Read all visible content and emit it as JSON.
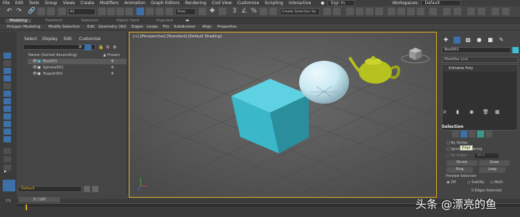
{
  "menu": [
    "File",
    "Edit",
    "Tools",
    "Group",
    "Views",
    "Create",
    "Modifiers",
    "Animation",
    "Graph Editors",
    "Rendering",
    "Civil View",
    "Customize",
    "Scripting",
    "Interactive"
  ],
  "signin": "Sign In",
  "workspaces": {
    "label": "Workspaces:",
    "value": "Default"
  },
  "toolbar": {
    "selection_filter": "All",
    "ref_coord": "View",
    "selection_set": "Create Selection Se"
  },
  "ribbon_tabs": [
    "Modeling",
    "Freeform",
    "Selection",
    "Object Paint",
    "Populate"
  ],
  "ribbon_tools": [
    "Polygon Modeling",
    "Modify Selection",
    "Edit",
    "Geometry (All)",
    "Edges",
    "Loops",
    "Tris",
    "Subdivision",
    "Align",
    "Properties"
  ],
  "scene_explorer": {
    "tabs": [
      "Select",
      "Display",
      "Edit",
      "Customize"
    ],
    "column_name": "Name (Sorted Ascending)",
    "column_frozen": "▲ Frozen",
    "rows": [
      {
        "name": "Box001"
      },
      {
        "name": "Sphere001"
      },
      {
        "name": "Teapot001"
      }
    ]
  },
  "layer": "Default",
  "viewport": {
    "label": "[+] [Perspective] [Standard] [Default Shading]"
  },
  "command_panel": {
    "object_name": "Box001",
    "object_color": "#3ac1d8",
    "modifier_list": "Modifier List",
    "stack_item": "Editable Poly",
    "selection_title": "Selection",
    "by_vertex": "By Vertex",
    "ignore_backfacing": "Ignore Backfacing",
    "by_angle": "By Angle:",
    "angle_value": "45.0",
    "tooltip": "Edge",
    "shrink": "Shrink",
    "grow": "Grow",
    "ring": "Ring",
    "loop": "Loop",
    "preview_selection": "Preview Selection",
    "preview_options": [
      "Off",
      "SubObj",
      "Multi"
    ],
    "edges_selected": "0 Edges Selected"
  },
  "timeline": {
    "frame": "0 / 100",
    "percent": "1%"
  },
  "watermark": "头条 @漂亮的鱼",
  "colors": {
    "viewport_border": "#e3b11e",
    "box": "#3ab8ca",
    "teapot": "#b6c21d",
    "sphere": "#c9e9f3"
  }
}
